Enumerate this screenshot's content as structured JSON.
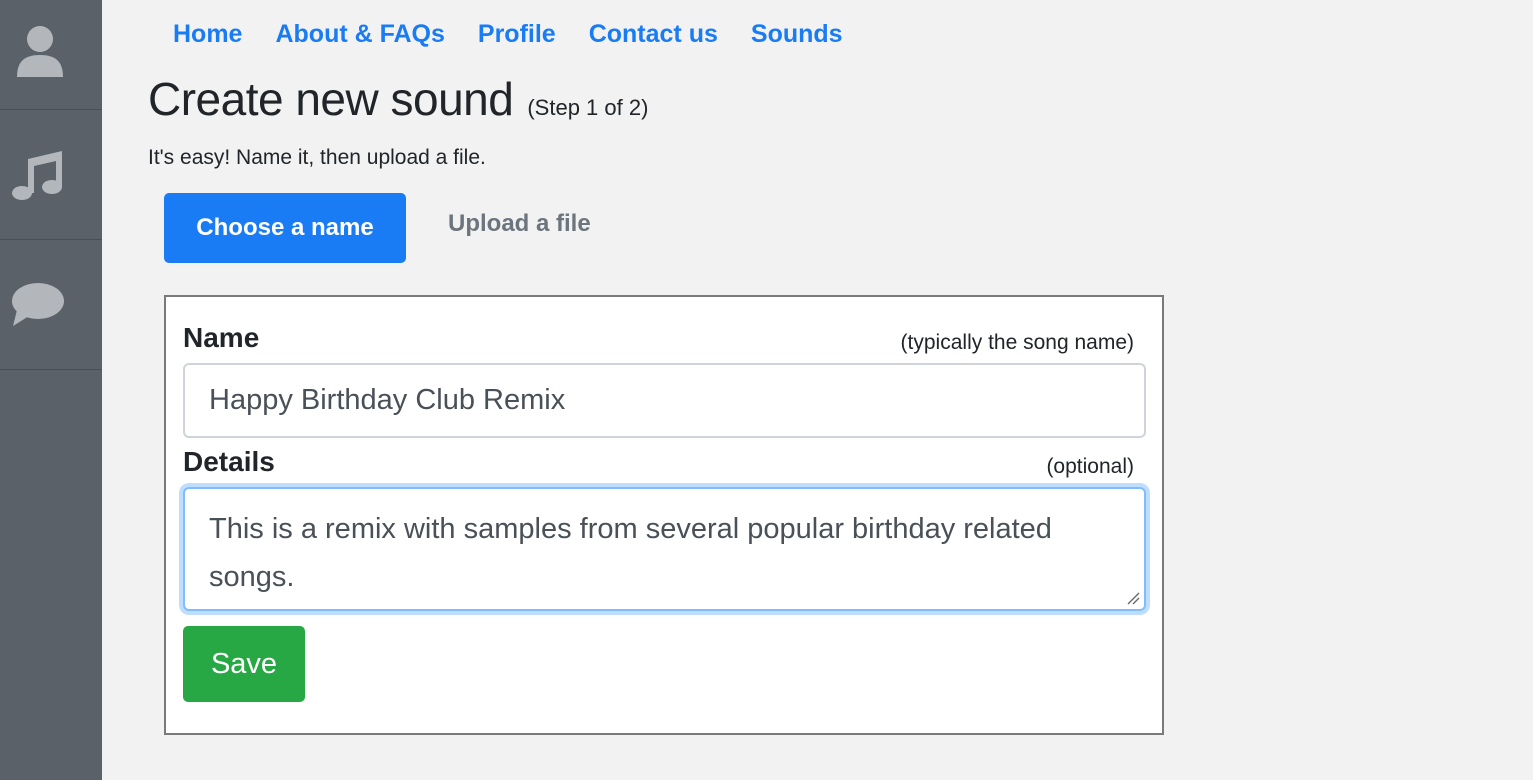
{
  "sidebar": {
    "items": [
      {
        "icon": "user-icon"
      },
      {
        "icon": "music-note-icon"
      },
      {
        "icon": "chat-bubble-icon"
      }
    ]
  },
  "nav": {
    "links": [
      "Home",
      "About & FAQs",
      "Profile",
      "Contact us",
      "Sounds"
    ]
  },
  "page": {
    "title": "Create new sound",
    "step": "(Step 1 of 2)",
    "intro": "It's easy! Name it, then upload a file."
  },
  "tabs": {
    "active": "Choose a name",
    "inactive": "Upload a file"
  },
  "form": {
    "name_label": "Name",
    "name_hint": "(typically the song name)",
    "name_value": "Happy Birthday Club Remix",
    "details_label": "Details",
    "details_hint": "(optional)",
    "details_value": "This is a remix with samples from several popular birthday related songs.",
    "save_label": "Save"
  },
  "colors": {
    "sidebar": "#5b6169",
    "link": "#1a7cf5",
    "active_tab": "#1a7cf5",
    "save": "#28a745",
    "icon": "#b3b7bc"
  }
}
